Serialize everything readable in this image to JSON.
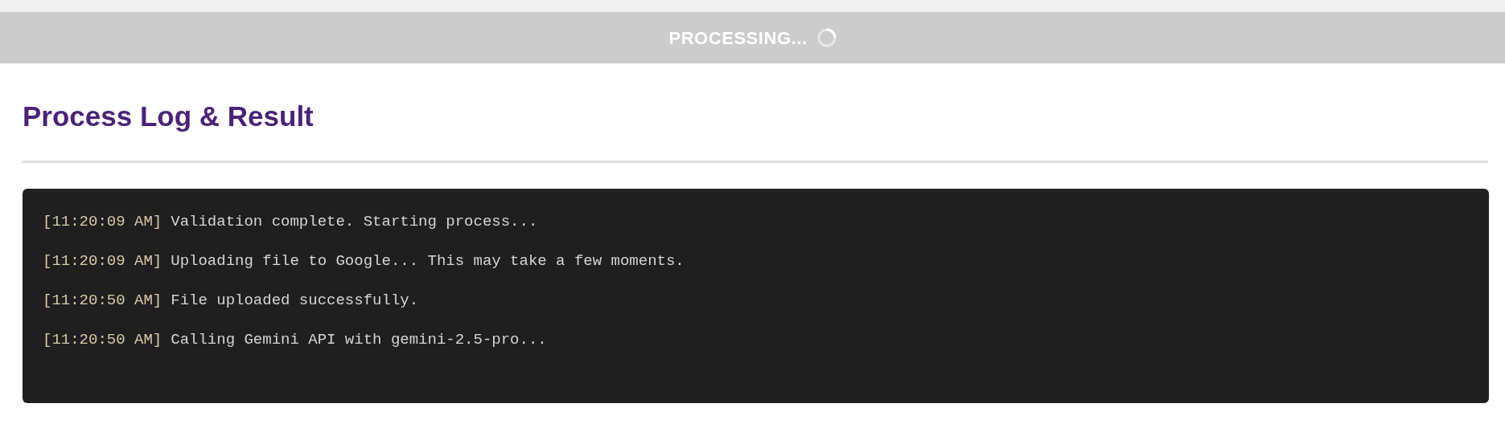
{
  "submit_button": {
    "label": "PROCESSING...",
    "disabled": true,
    "busy": true
  },
  "section": {
    "title": "Process Log & Result"
  },
  "log": [
    {
      "time": "[11:20:09 AM]",
      "message": "Validation complete. Starting process..."
    },
    {
      "time": "[11:20:09 AM]",
      "message": "Uploading file to Google... This may take a few moments."
    },
    {
      "time": "[11:20:50 AM]",
      "message": "File uploaded successfully."
    },
    {
      "time": "[11:20:50 AM]",
      "message": "Calling Gemini API with gemini-2.5-pro..."
    }
  ]
}
